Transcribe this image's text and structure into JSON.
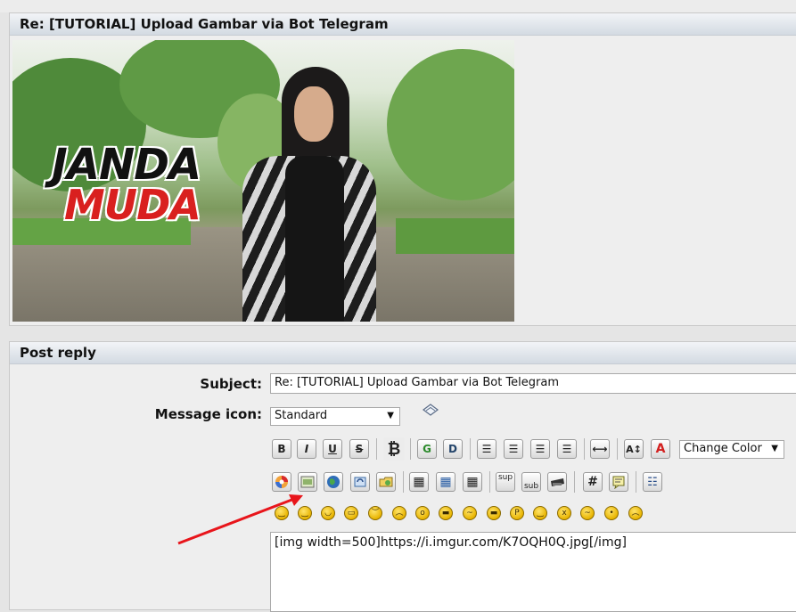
{
  "topic": {
    "title": "Re: [TUTORIAL] Upload Gambar via Bot Telegram",
    "image_text_line1": "JANDA",
    "image_text_line2": "MUDA"
  },
  "reply": {
    "header": "Post reply",
    "subject_label": "Subject:",
    "subject_value": "Re: [TUTORIAL] Upload Gambar via Bot Telegram",
    "icon_label": "Message icon:",
    "icon_value": "Standard",
    "change_color": "Change Color",
    "message": "[img width=500]https://i.imgur.com/K7OQH0Q.jpg[/img]"
  },
  "toolbar": {
    "bold": "B",
    "italic": "I",
    "underline": "U",
    "strike": "S",
    "bitcoin": "₿",
    "g": "G",
    "d": "D",
    "font_size": "A↕",
    "font_color": "A",
    "sup": "sup",
    "sub": "sub",
    "hash": "#"
  },
  "colors": {
    "accent_arrow": "#e8151b",
    "header_grad_top": "#f2f4f7",
    "header_grad_bottom": "#d3dae2"
  }
}
